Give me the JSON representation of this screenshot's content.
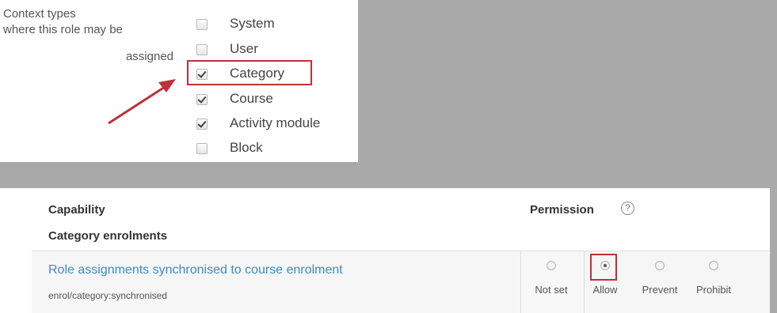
{
  "context": {
    "label_line1": "Context types",
    "label_line2": "where this role may be",
    "label_line3": "assigned",
    "items": [
      {
        "label": "System",
        "checked": false
      },
      {
        "label": "User",
        "checked": false
      },
      {
        "label": "Category",
        "checked": true
      },
      {
        "label": "Course",
        "checked": true
      },
      {
        "label": "Activity module",
        "checked": true
      },
      {
        "label": "Block",
        "checked": false
      }
    ]
  },
  "capabilities": {
    "capability_header": "Capability",
    "permission_header": "Permission",
    "help_glyph": "?",
    "group": "Category enrolments",
    "row": {
      "name": "Role assignments synchronised to course enrolment",
      "code": "enrol/category:synchronised"
    },
    "permissions": [
      {
        "label": "Not set",
        "selected": false
      },
      {
        "label": "Allow",
        "selected": true
      },
      {
        "label": "Prevent",
        "selected": false
      },
      {
        "label": "Prohibit",
        "selected": false
      }
    ]
  },
  "colors": {
    "highlight": "#c0303a",
    "link": "#3a8fc7",
    "background_gray": "#a9a9a9"
  }
}
